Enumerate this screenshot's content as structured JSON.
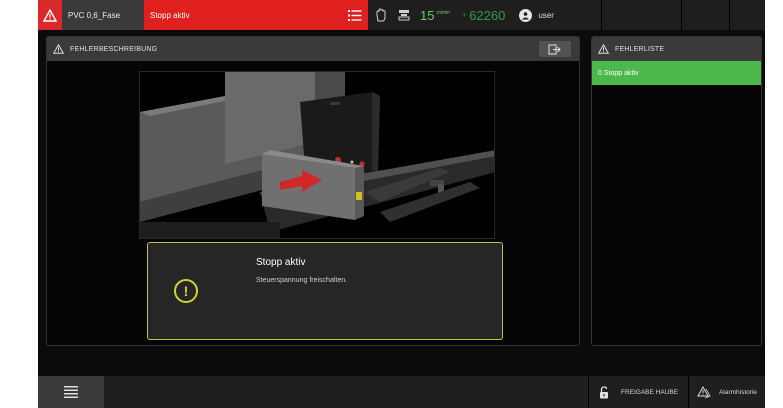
{
  "topbar": {
    "program": "PVC 0,6_Fase",
    "status": "Stopp aktiv",
    "speed_value": "15",
    "speed_unit": "m/min",
    "counter_prefix": "+",
    "counter": "62260",
    "user": "user"
  },
  "main_panel": {
    "title": "FEHLERBESCHREIBUNG"
  },
  "message": {
    "title": "Stopp aktiv",
    "text": "Steuerspannung freischalten."
  },
  "error_list": {
    "title": "FEHLERLISTE",
    "items": [
      "0 Stopp aktiv"
    ]
  },
  "bottombar": {
    "release_label": "FREIGABE HAUBE",
    "history_label": "Alarmhistorie"
  },
  "colors": {
    "alarm_red": "#e01f1f",
    "active_green": "#4cb84c",
    "warning_yellow": "#d4d132"
  }
}
